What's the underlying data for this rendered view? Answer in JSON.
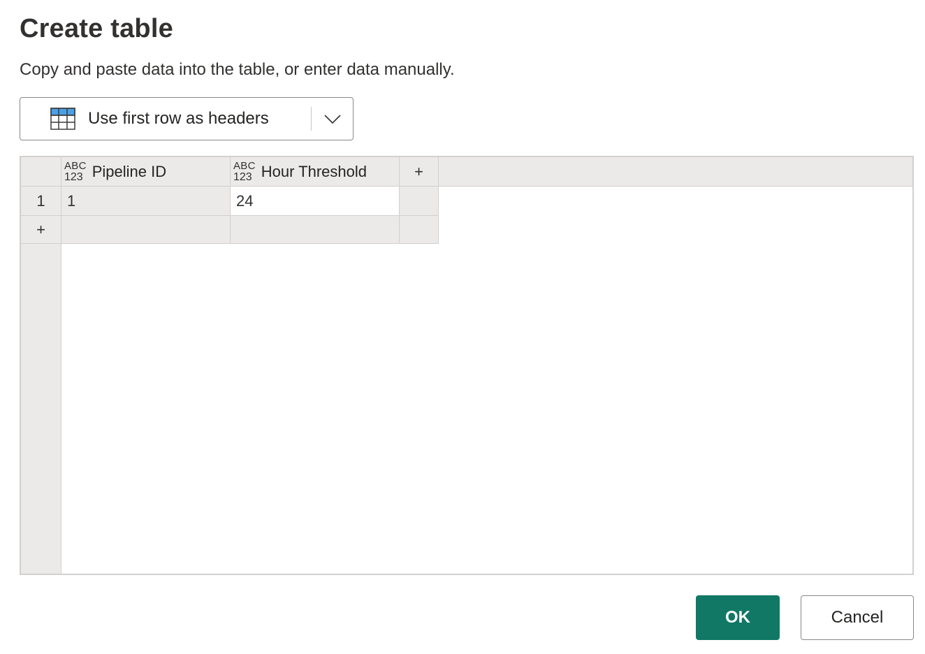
{
  "dialog": {
    "title": "Create table",
    "subtitle": "Copy and paste data into the table, or enter data manually."
  },
  "headers_button": {
    "label": "Use first row as headers",
    "icon": "table-header-icon",
    "dropdown_icon": "chevron-down-icon"
  },
  "table": {
    "type_badge_top": "ABC",
    "type_badge_bottom": "123",
    "columns": [
      "Pipeline ID",
      "Hour Threshold"
    ],
    "add_column_label": "+",
    "add_row_label": "+",
    "rows": [
      {
        "number": "1",
        "cells": [
          "1",
          "24"
        ]
      }
    ]
  },
  "footer": {
    "ok_label": "OK",
    "cancel_label": "Cancel"
  },
  "colors": {
    "primary": "#117865",
    "grid_background": "#ebeae9",
    "border": "#d2d0ce"
  }
}
